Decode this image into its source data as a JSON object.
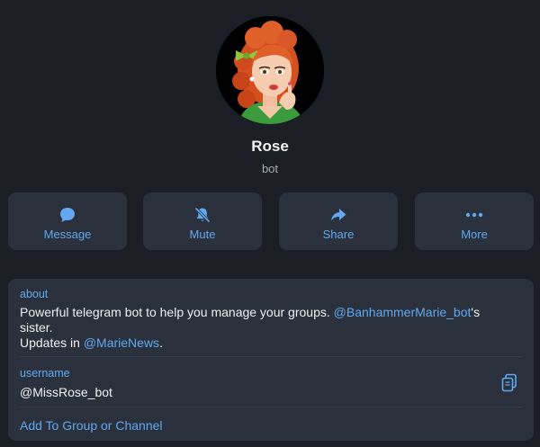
{
  "profile": {
    "name": "Rose",
    "subtitle": "bot",
    "avatar_icon": "rose-avatar-illustration"
  },
  "actions": [
    {
      "label": "Message",
      "icon": "message-bubble-icon"
    },
    {
      "label": "Mute",
      "icon": "bell-slash-icon"
    },
    {
      "label": "Share",
      "icon": "share-arrow-icon"
    },
    {
      "label": "More",
      "icon": "more-dots-icon"
    }
  ],
  "info": {
    "about_label": "about",
    "about_text_part1": "Powerful telegram bot to help you manage your groups. ",
    "about_link1": "@BanhammerMarie_bot",
    "about_text_part2": "'s sister.",
    "about_text_part3": "Updates in ",
    "about_link2": "@MarieNews",
    "about_text_part4": ".",
    "username_label": "username",
    "username_value": "@MissRose_bot",
    "copy_icon": "copy-icon",
    "add_action": "Add To Group or Channel"
  },
  "colors": {
    "background": "#1b1e24",
    "card": "#2a313c",
    "accent": "#61a8f0",
    "text": "#f0f0f0",
    "muted": "#a6adb5"
  }
}
